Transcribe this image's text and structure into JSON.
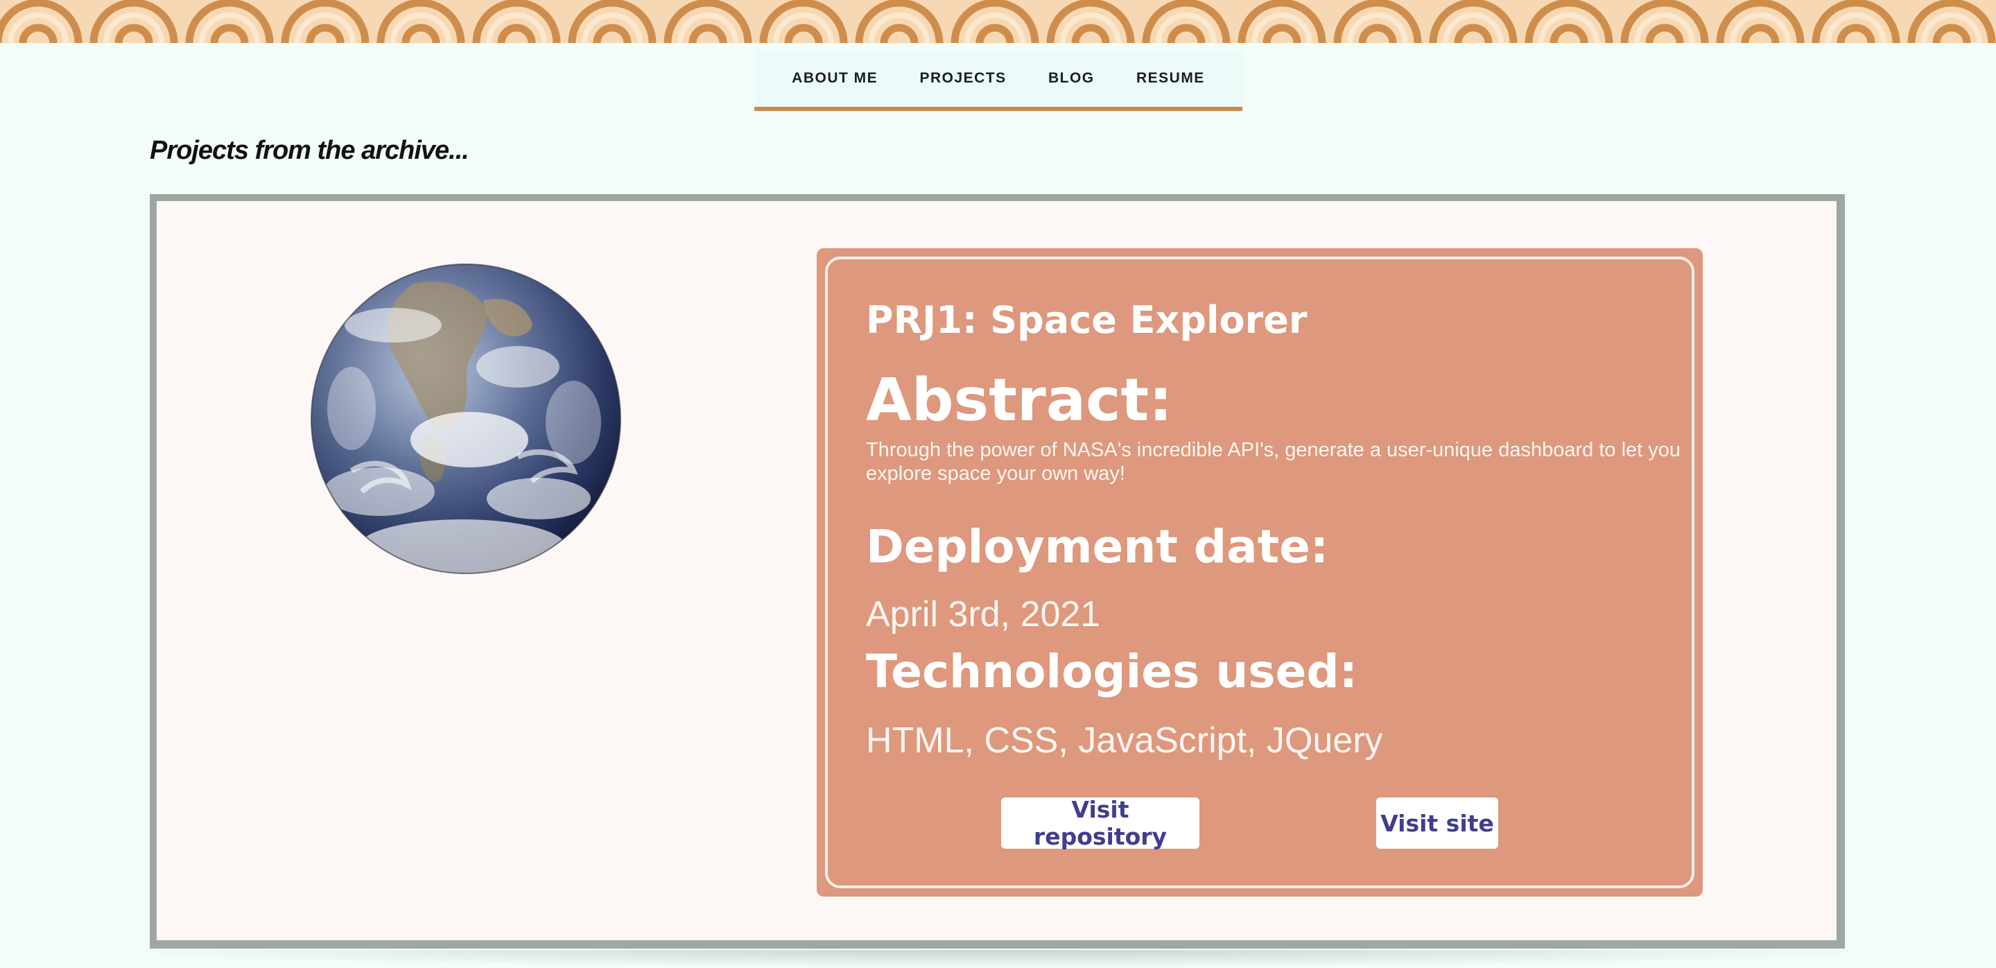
{
  "nav": {
    "items": [
      {
        "label": "ABOUT ME"
      },
      {
        "label": "PROJECTS"
      },
      {
        "label": "BLOG"
      },
      {
        "label": "RESUME"
      }
    ]
  },
  "archive": {
    "heading": "Projects from the archive..."
  },
  "project": {
    "title": "PRJ1: Space Explorer",
    "abstract_heading": "Abstract:",
    "abstract_text": "Through the power of NASA's incredible API's, generate a user-unique dashboard to let you explore space your own way!",
    "deployment_heading": "Deployment date:",
    "deployment_date": "April 3rd, 2021",
    "technologies_heading": "Technologies used:",
    "technologies": "HTML, CSS, JavaScript, JQuery",
    "repo_button": "Visit repository",
    "site_button": "Visit site",
    "image_icon": "earth-globe-image"
  },
  "colors": {
    "background": "#f2fdf8",
    "accent": "#c9894c",
    "card": "#dd987d",
    "button_text": "#3f3f8e",
    "frame_border": "#9ea7a1"
  }
}
